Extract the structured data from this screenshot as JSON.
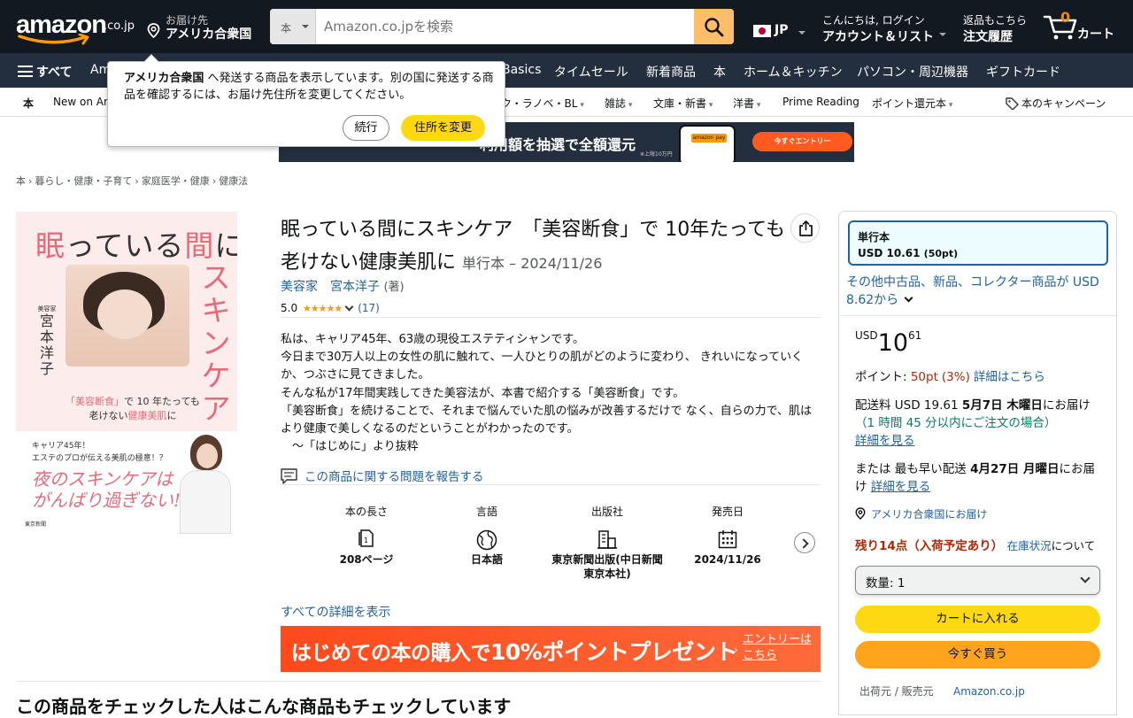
{
  "header": {
    "logo_text": "amazon",
    "logo_tld": ".co.jp",
    "deliver_line1": "お届け先",
    "deliver_line2": "アメリカ合衆国",
    "search_category": "本",
    "search_placeholder": "Amazon.co.jpを検索",
    "lang_code": "JP",
    "account_line1": "こんにちは, ログイン",
    "account_line2": "アカウント＆リスト",
    "orders_line1": "返品もこちら",
    "orders_line2": "注文履歴",
    "cart_count": "0",
    "cart_label": "カート"
  },
  "main_nav": {
    "all_label": "すべて",
    "items": [
      "Am",
      "Basics",
      "タイムセール",
      "新着商品",
      "本",
      "ホーム＆キッチン",
      "パソコン・周辺機器",
      "ギフトカード"
    ]
  },
  "sub_nav": {
    "first": "本",
    "items": [
      "New on Am",
      "ク・ラノベ・BL",
      "雑誌",
      "文庫・新書",
      "洋書",
      "Prime Reading",
      "ポイント還元本"
    ],
    "campaign": "本のキャンペーン"
  },
  "banner": {
    "text": "利用額を抽選で全額還元",
    "pay_label": "amazon pay",
    "small_note": "※上限10万円",
    "cta": "今すぐエントリー"
  },
  "popover": {
    "country": "アメリカ合衆国",
    "message": " へ発送する商品を表示しています。別の国に発送する商品を確認するには、お届け先住所を変更してください。",
    "continue": "続行",
    "change": "住所を変更"
  },
  "breadcrumb": [
    "本",
    "暮らし・健康・子育て",
    "家庭医学・健康",
    "健康法"
  ],
  "cover": {
    "title_a": "眠",
    "title_b": "っている",
    "title_c": "間",
    "title_d": "に",
    "vertical": "スキンケア",
    "author_role": "美容家",
    "author": "宮本洋子",
    "subtitle_a": "「美容断食」",
    "subtitle_b": "で 10 年たっても",
    "subtitle_c": "老けない",
    "subtitle_d": "健康美肌",
    "subtitle_e": "に",
    "lower_line1": "キャリア45年！",
    "lower_line2": "エステのプロが伝える美肌の極意！？",
    "lower_big1": "夜のスキンケアは",
    "lower_big2": "がんばり過ぎない!!",
    "publisher_mark": "東京新聞"
  },
  "product": {
    "title": "眠っている間にスキンケア　「美容断食」で 10年たっても老けない健康美肌に",
    "format_date": "単行本 – 2024/11/26",
    "author_role_link": "美容家",
    "author_link": "宮本洋子",
    "author_role": "(著)",
    "rating": "5.0",
    "stars": "★★★★★",
    "review_count": "(17)",
    "description": [
      "私は、キャリア45年、63歳の現役エステティシャンです。",
      "今日まで30万人以上の女性の肌に触れて、一人ひとりの肌がどのように変わり、 きれいになっていくか、つぶさに見てきました。",
      "そんな私が17年間実践してきた美容法が、本書で紹介する「美容断食」です。",
      "「美容断食」を続けることで、それまで悩んでいた肌の悩みが改善するだけで なく、自らの力で、肌はより健康で美しくなるのだということがわかったのです。",
      "　～「はじめに」より抜粋"
    ],
    "report_issue": "この商品に関する問題を報告する",
    "details": [
      {
        "label": "本の長さ",
        "icon": "page-count-icon",
        "value": "208ページ"
      },
      {
        "label": "言語",
        "icon": "globe-icon",
        "value": "日本語"
      },
      {
        "label": "出版社",
        "icon": "building-icon",
        "value": "東京新聞出版(中日新聞東京本社)"
      },
      {
        "label": "発売日",
        "icon": "calendar-icon",
        "value": "2024/11/26"
      }
    ],
    "all_details": "すべての詳細を表示",
    "promo_a": "はじめての本の購入で",
    "promo_b": "10%ポイントプレゼント",
    "promo_entry": "エントリーはこちら",
    "also_viewed": "この商品をチェックした人はこんな商品もチェックしています"
  },
  "buybox": {
    "format_name": "単行本",
    "format_price": "USD 10.61",
    "format_points": "(50pt)",
    "other_offers": "その他中古品、新品、コレクター商品が USD 8.62から",
    "price_currency": "USD",
    "price_int": "10",
    "price_dec": "61",
    "points_label": "ポイント: ",
    "points_value": "50pt",
    "points_pct": "(3%)",
    "points_link": "詳細はこちら",
    "shipping_a": "配送料 USD 19.61 ",
    "shipping_date": "5月7日 木曜日",
    "shipping_b": "にお届け",
    "shipping_c": "（",
    "shipping_countdown": "1 時間 45 分",
    "shipping_d": "以内にご注文の場合）",
    "shipping_link": "詳細を見る",
    "fastest_a": "または 最も早い配送 ",
    "fastest_date": "4月27日 月曜日",
    "fastest_b": "にお届け ",
    "fastest_link": "詳細を見る",
    "deliver_to": "アメリカ合衆国にお届け",
    "stock": "残り14点（入荷予定あり）",
    "stock_link": "在庫状況",
    "stock_tail": "について",
    "qty_label": "数量: ",
    "qty_value": "1",
    "add_to_cart": "カートに入れる",
    "buy_now": "今すぐ買う",
    "seller_label": "出荷元 / 販売元",
    "seller_value": "Amazon.co.jp"
  },
  "colors": {
    "nav_dark": "#131921",
    "nav_mid": "#232f3e",
    "search_button": "#febd69",
    "cart_button": "#ffd814",
    "buy_button": "#ffa41c",
    "link": "#2162a1",
    "price_red": "#b12704",
    "star": "#ff9900"
  }
}
